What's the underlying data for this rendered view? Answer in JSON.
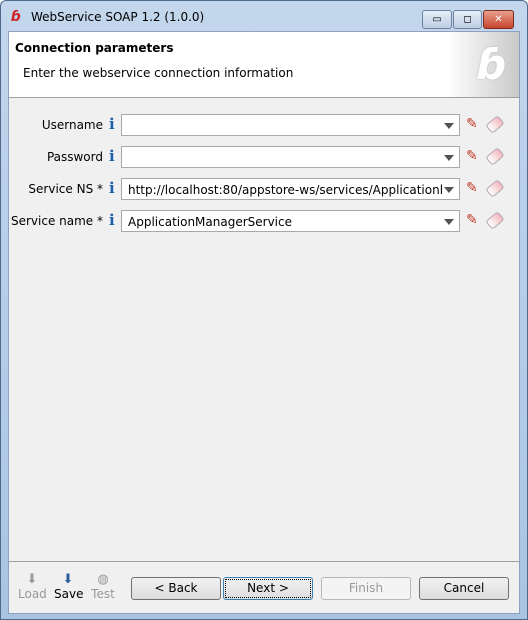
{
  "window": {
    "title": "WebService SOAP 1.2 (1.0.0)",
    "minimize": "▭",
    "maximize": "◻",
    "close": "✕"
  },
  "header": {
    "title": "Connection parameters",
    "subtitle": "Enter the webservice connection information"
  },
  "fields": [
    {
      "label": "Username",
      "value": ""
    },
    {
      "label": "Password",
      "value": ""
    },
    {
      "label": "Service NS *",
      "value": "http://localhost:80/appstore-ws/services/Applicationl"
    },
    {
      "label": "Service name *",
      "value": "ApplicationManagerService"
    }
  ],
  "toolbar": {
    "load": "Load",
    "save": "Save",
    "test": "Test"
  },
  "buttons": {
    "back": "< Back",
    "next": "Next >",
    "finish": "Finish",
    "cancel": "Cancel"
  },
  "colors": {
    "accent": "#1d5fa8",
    "logo": "#d0242a"
  }
}
